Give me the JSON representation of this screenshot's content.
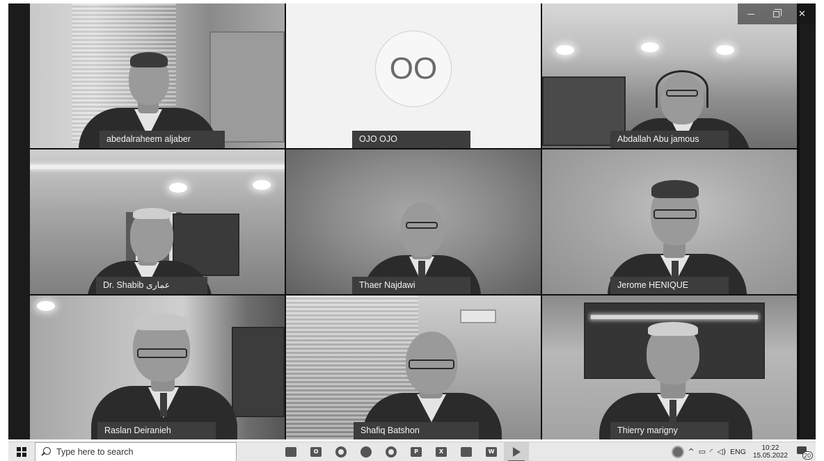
{
  "window": {
    "minimize_label": "–",
    "maximize_icon": "restore-icon",
    "close_label": "✕"
  },
  "participants": [
    {
      "name": "abedalraheem aljaber"
    },
    {
      "name": "OJO OJO",
      "initials": "OO"
    },
    {
      "name": "Abdallah Abu jamous"
    },
    {
      "name": "Dr. Shabib عماری"
    },
    {
      "name": "Thaer Najdawi"
    },
    {
      "name": "Jerome HENIQUE"
    },
    {
      "name": "Raslan Deiranieh"
    },
    {
      "name": "Shafiq Batshon"
    },
    {
      "name": "Thierry marigny"
    }
  ],
  "taskbar": {
    "search_placeholder": "Type here to search",
    "pinned": [
      {
        "icon": "file-explorer-icon",
        "label": "▬"
      },
      {
        "icon": "outlook-icon",
        "label": "O"
      },
      {
        "icon": "settings-icon",
        "label": ""
      },
      {
        "icon": "edge-icon",
        "label": ""
      },
      {
        "icon": "chrome-icon",
        "label": ""
      },
      {
        "icon": "powerpoint-icon",
        "label": "P"
      },
      {
        "icon": "excel-icon",
        "label": "X"
      },
      {
        "icon": "photos-icon",
        "label": "▲"
      },
      {
        "icon": "word-icon",
        "label": "W"
      },
      {
        "icon": "meeting-app-icon",
        "label": ""
      }
    ],
    "tray": {
      "language": "ENG",
      "time": "10:22",
      "date": "15.05.2022",
      "notifications": "20"
    }
  }
}
